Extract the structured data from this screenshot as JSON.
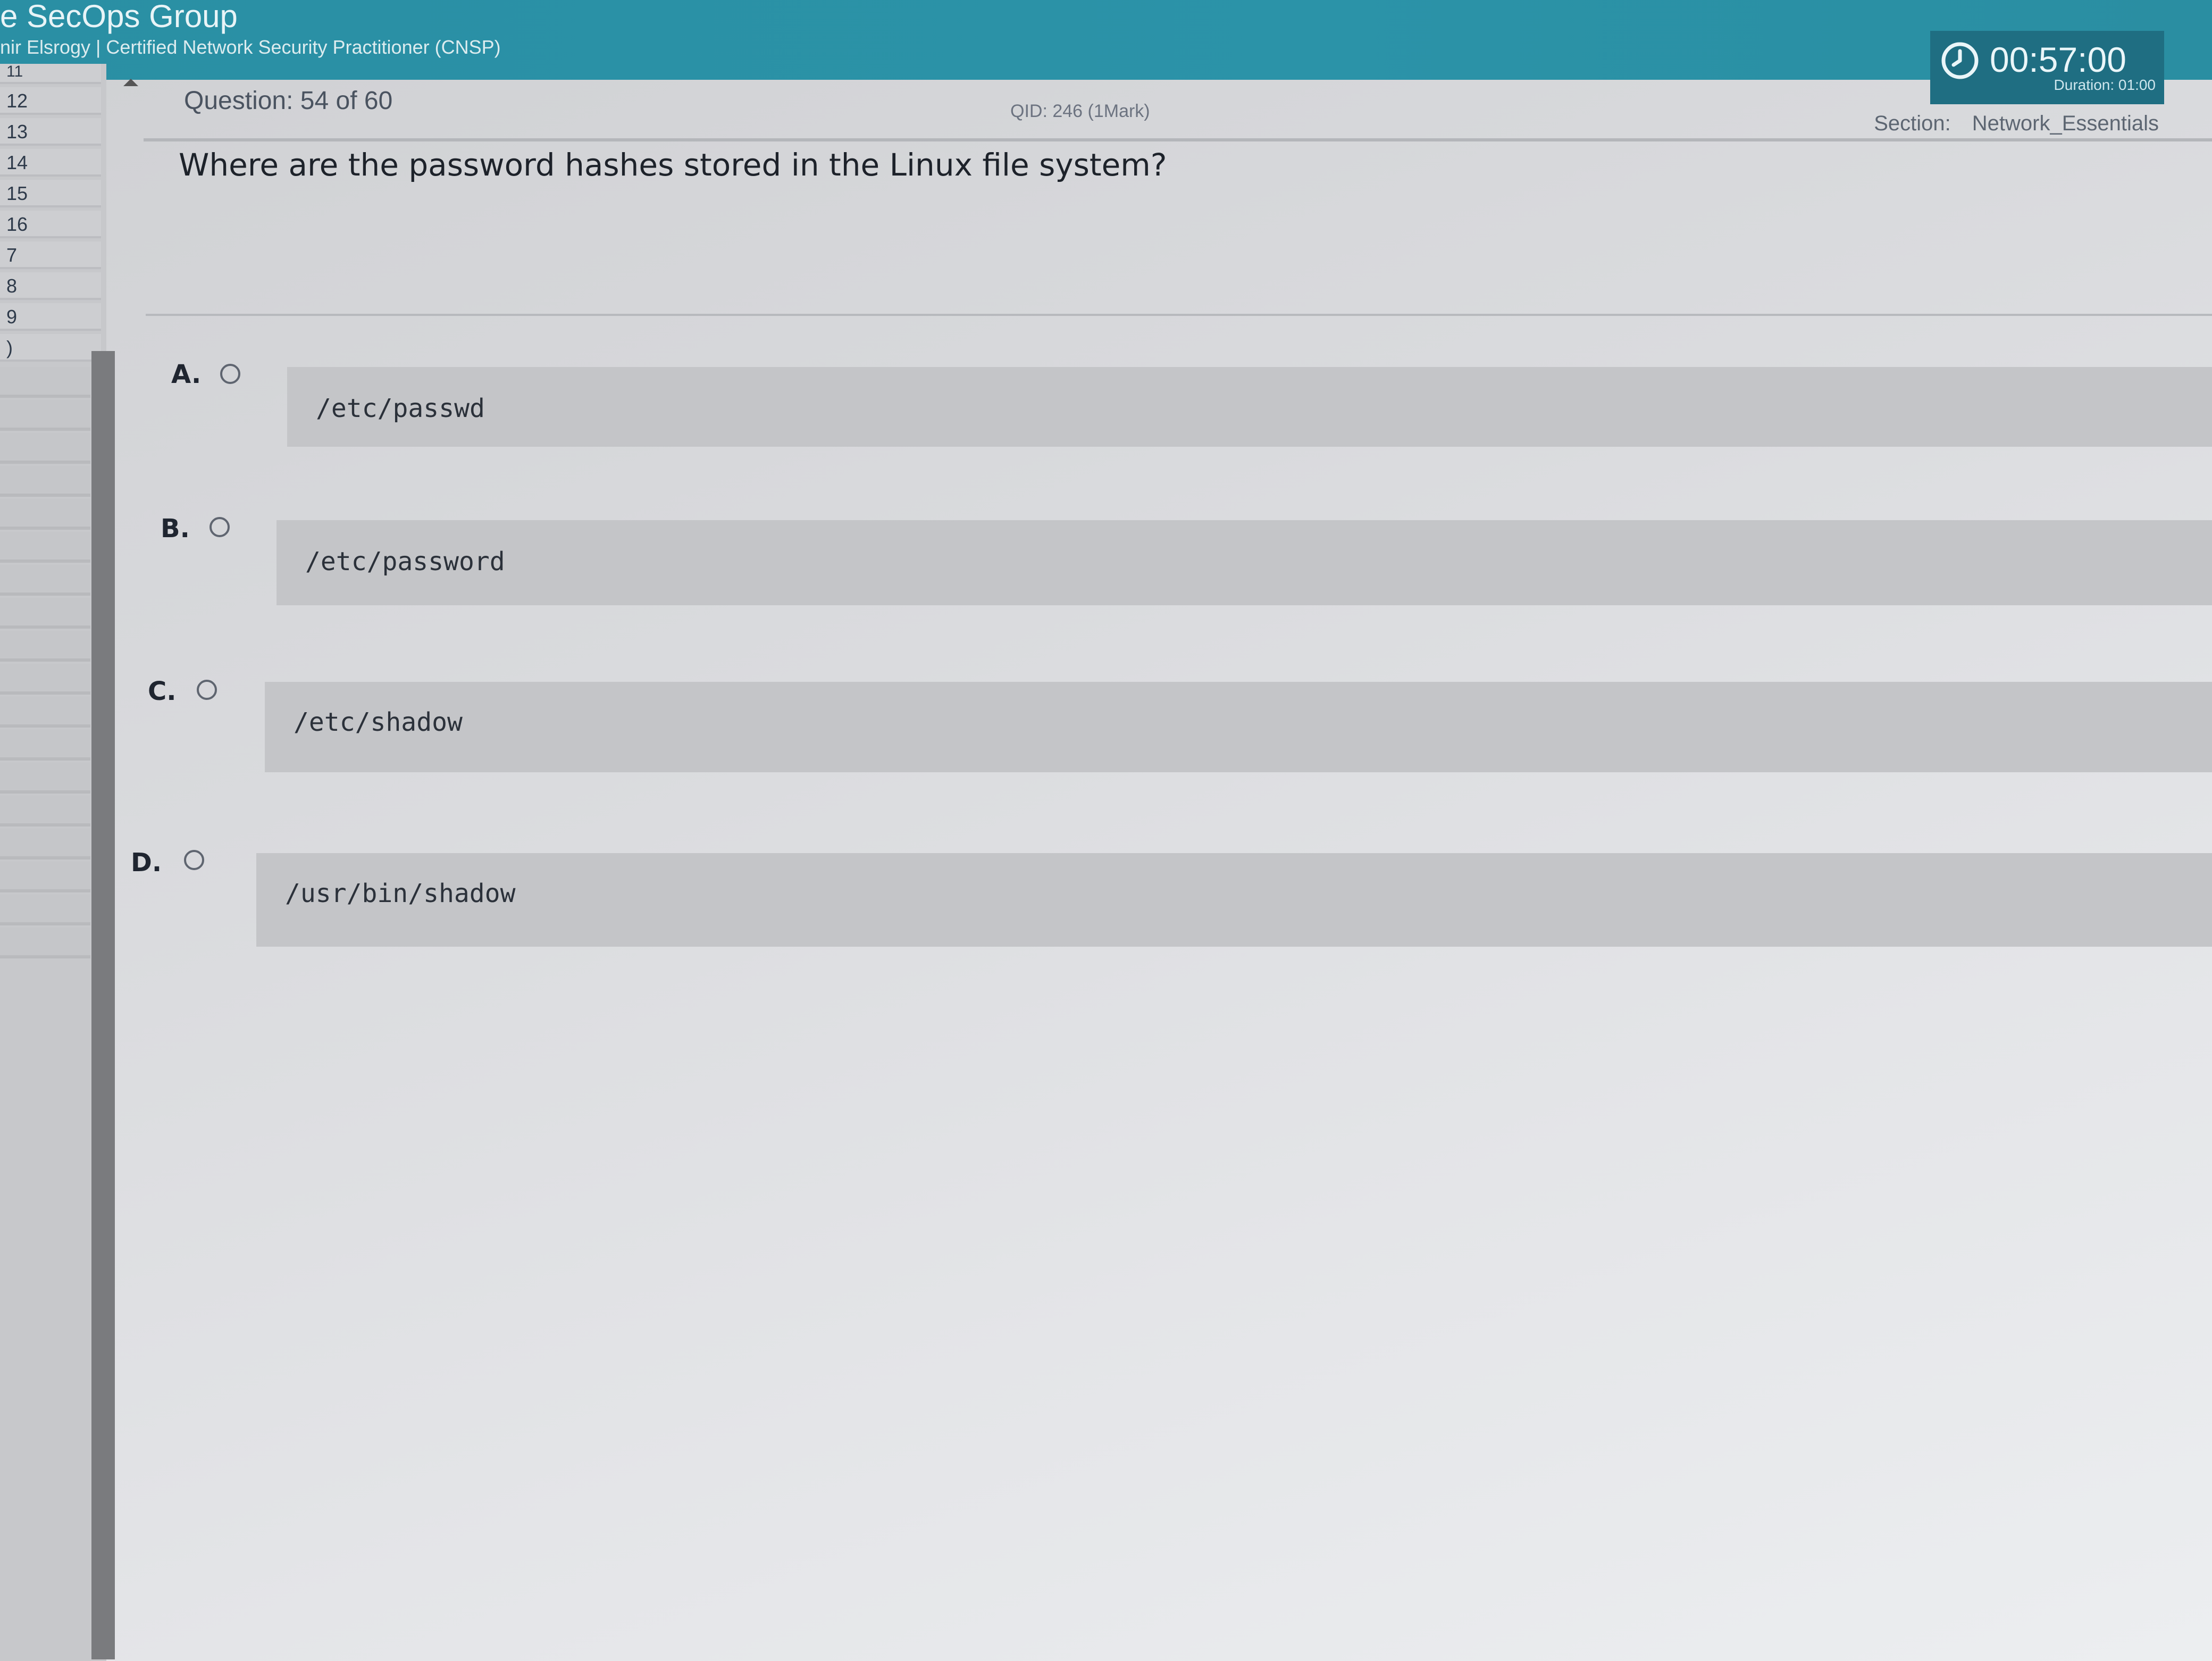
{
  "header": {
    "brand": "e SecOps Group",
    "subtitle": "nir Elsrogy | Certified Network Security Practitioner (CNSP)"
  },
  "timer": {
    "icon": "clock-icon",
    "value": "00:57:00",
    "duration": "Duration: 01:00"
  },
  "nav": {
    "partial_top": "11",
    "items": [
      "12",
      "13",
      "14",
      "15",
      "16",
      "7",
      "8",
      "9",
      ")"
    ]
  },
  "question_bar": {
    "number": "Question: 54 of 60",
    "qid": "QID: 246 (1Mark)",
    "section_label": "Section:",
    "section_value": "Network_Essentials"
  },
  "question": {
    "text": "Where are the password hashes stored in the Linux file system?"
  },
  "options": [
    {
      "letter": "A.",
      "text": "/etc/passwd"
    },
    {
      "letter": "B.",
      "text": "/etc/password"
    },
    {
      "letter": "C.",
      "text": "/etc/shadow"
    },
    {
      "letter": "D.",
      "text": "/usr/bin/shadow"
    }
  ],
  "colors": {
    "header": "#2b93a8",
    "timer_bg": "#1f6e82",
    "page_bg": "#d9dadd",
    "option_bg": "#c4c5c8"
  }
}
